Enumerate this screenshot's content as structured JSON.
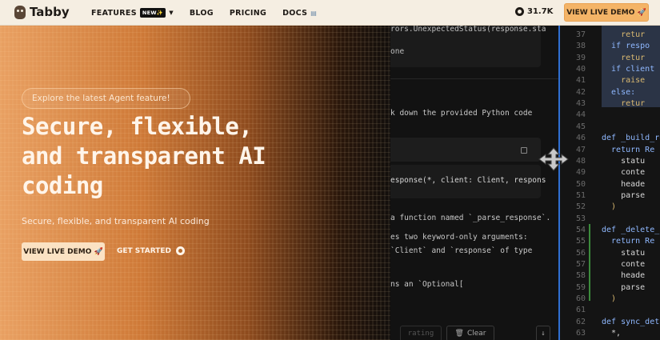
{
  "nav": {
    "brand": "Tabby",
    "items": [
      {
        "label": "FEATURES",
        "badge": "NEW✨"
      },
      {
        "label": "BLOG"
      },
      {
        "label": "PRICING"
      },
      {
        "label": "DOCS"
      }
    ],
    "github_stars": "31.7K",
    "cta": "VIEW LIVE DEMO 🚀"
  },
  "hero": {
    "pill": "Explore the latest Agent feature!",
    "headline": "Secure, flexible, and transparent AI coding",
    "subtitle": "Secure, flexible, and transparent AI coding",
    "cta_primary": "VIEW LIVE DEMO 🚀",
    "cta_secondary": "GET STARTED"
  },
  "chat": {
    "lines": [
      "rors.UnexpectedStatus(response.sta",
      "one",
      "k down the provided Python code",
      "esponse(*, client: Client, respons",
      "a function named `_parse_response`.",
      "es two keyword-only arguments:",
      "`Client` and `response` of type",
      "ns an `Optional[",
      "rating",
      "Clear"
    ]
  },
  "editor": {
    "line_numbers": [
      "37",
      "38",
      "39",
      "40",
      "41",
      "42",
      "43",
      "44",
      "45",
      "46",
      "47",
      "48",
      "49",
      "50",
      "51",
      "52",
      "53",
      "54",
      "55",
      "56",
      "57",
      "58",
      "59",
      "60",
      "61",
      "62",
      "63"
    ],
    "code": [
      "    retur",
      "  if respo",
      "    retur",
      "  if client",
      "    raise",
      "  else:",
      "    retur",
      "",
      "",
      "def _build_re",
      "  return Re",
      "    statu",
      "    conte",
      "    heade",
      "    parse",
      "  )",
      "",
      "def _delete_",
      "  return Re",
      "    statu",
      "    conte",
      "    heade",
      "    parse",
      "  )",
      "",
      "def sync_deta",
      "  *,"
    ]
  },
  "colors": {
    "accent": "#f4b467",
    "nav_bg": "#f5eee2",
    "divider": "#2f6fd1"
  }
}
